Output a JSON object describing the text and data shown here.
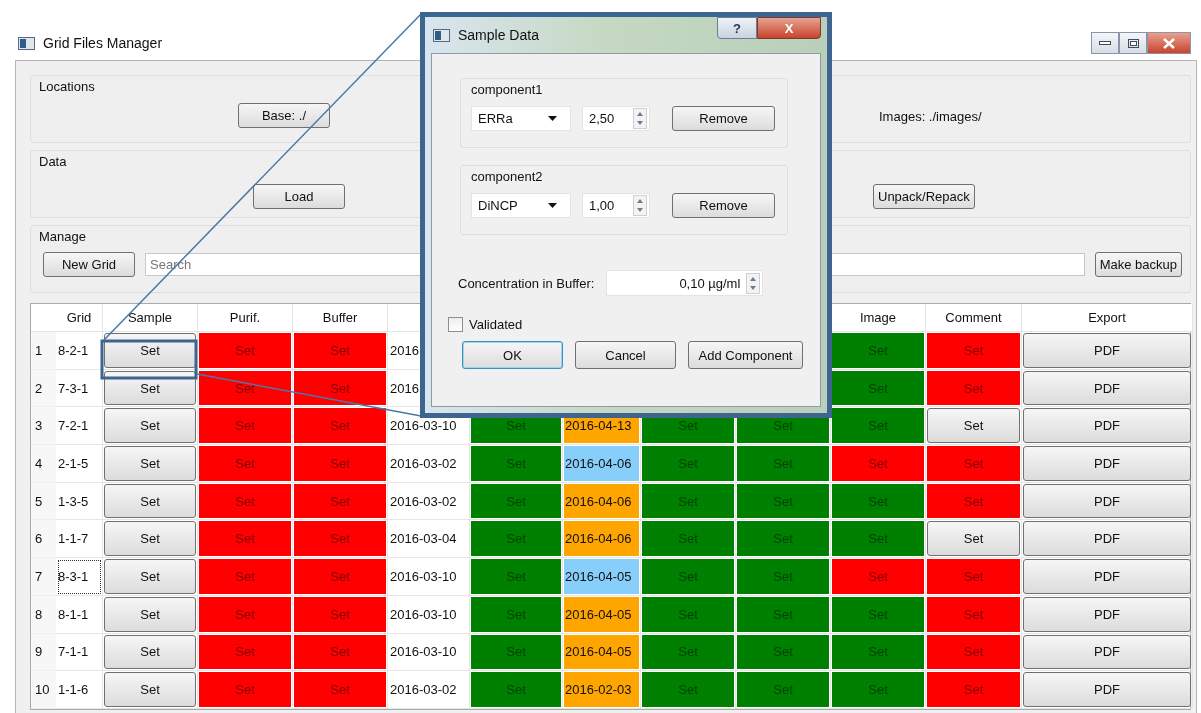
{
  "window": {
    "title": "Grid Files Manager"
  },
  "locations": {
    "title": "Locations",
    "base_button": "Base: ./",
    "images_label": "Images: ./images/"
  },
  "data": {
    "title": "Data",
    "load_button": "Load",
    "unpack_button": "Unpack/Repack"
  },
  "manage": {
    "title": "Manage",
    "new_grid_button": "New Grid",
    "search": {
      "placeholder": "Search"
    },
    "backup_button": "Make backup"
  },
  "table": {
    "header": {
      "grid": "Grid",
      "sample": "Sample",
      "purif": "Purif.",
      "buffer": "Buffer",
      "image": "Image",
      "comment": "Comment",
      "export": "Export"
    },
    "rows": [
      {
        "row_number": "1",
        "focused": false,
        "grid": {
          "kind": "text",
          "text": "8-2-1"
        },
        "sample": {
          "kind": "button",
          "text": "Set"
        },
        "purif": {
          "kind": "status",
          "text": "Set",
          "color": "#ff0000"
        },
        "buffer": {
          "kind": "status",
          "text": "Set",
          "color": "#ff0000"
        },
        "column_5": {
          "kind": "text",
          "text": "2016"
        },
        "image": {
          "kind": "status",
          "text": "Set",
          "color": "#008000"
        },
        "comment": {
          "kind": "status",
          "text": "Set",
          "color": "#ff0000"
        },
        "export": {
          "kind": "button",
          "text": "PDF"
        }
      },
      {
        "row_number": "2",
        "focused": false,
        "grid": {
          "kind": "text",
          "text": "7-3-1"
        },
        "sample": {
          "kind": "button",
          "text": "Set"
        },
        "purif": {
          "kind": "status",
          "text": "Set",
          "color": "#ff0000"
        },
        "buffer": {
          "kind": "status",
          "text": "Set",
          "color": "#ff0000"
        },
        "column_5": {
          "kind": "text",
          "text": "2016"
        },
        "image": {
          "kind": "status",
          "text": "Set",
          "color": "#008000"
        },
        "comment": {
          "kind": "status",
          "text": "Set",
          "color": "#ff0000"
        },
        "export": {
          "kind": "button",
          "text": "PDF"
        }
      },
      {
        "row_number": "3",
        "focused": false,
        "grid": {
          "kind": "text",
          "text": "7-2-1"
        },
        "sample": {
          "kind": "button",
          "text": "Set"
        },
        "purif": {
          "kind": "status",
          "text": "Set",
          "color": "#ff0000"
        },
        "buffer": {
          "kind": "status",
          "text": "Set",
          "color": "#ff0000"
        },
        "column_5": {
          "kind": "text",
          "text": "2016-03-10"
        },
        "column_6": {
          "kind": "status",
          "text": "Set",
          "color": "#008000"
        },
        "column_7": {
          "kind": "text",
          "text": "2016-04-13",
          "color": "#ffa500"
        },
        "column_8": {
          "kind": "status",
          "text": "Set",
          "color": "#008000"
        },
        "column_9": {
          "kind": "status",
          "text": "Set",
          "color": "#008000"
        },
        "image": {
          "kind": "status",
          "text": "Set",
          "color": "#008000"
        },
        "comment": {
          "kind": "button",
          "text": "Set"
        },
        "export": {
          "kind": "button",
          "text": "PDF"
        }
      },
      {
        "row_number": "4",
        "focused": false,
        "grid": {
          "kind": "text",
          "text": "2-1-5"
        },
        "sample": {
          "kind": "button",
          "text": "Set"
        },
        "purif": {
          "kind": "status",
          "text": "Set",
          "color": "#ff0000"
        },
        "buffer": {
          "kind": "status",
          "text": "Set",
          "color": "#ff0000"
        },
        "column_5": {
          "kind": "text",
          "text": "2016-03-02"
        },
        "column_6": {
          "kind": "status",
          "text": "Set",
          "color": "#008000"
        },
        "column_7": {
          "kind": "text",
          "text": "2016-04-06",
          "color": "#87cefa"
        },
        "column_8": {
          "kind": "status",
          "text": "Set",
          "color": "#008000"
        },
        "column_9": {
          "kind": "status",
          "text": "Set",
          "color": "#008000"
        },
        "image": {
          "kind": "status",
          "text": "Set",
          "color": "#ff0000"
        },
        "comment": {
          "kind": "status",
          "text": "Set",
          "color": "#ff0000"
        },
        "export": {
          "kind": "button",
          "text": "PDF"
        }
      },
      {
        "row_number": "5",
        "focused": false,
        "grid": {
          "kind": "text",
          "text": "1-3-5"
        },
        "sample": {
          "kind": "button",
          "text": "Set"
        },
        "purif": {
          "kind": "status",
          "text": "Set",
          "color": "#ff0000"
        },
        "buffer": {
          "kind": "status",
          "text": "Set",
          "color": "#ff0000"
        },
        "column_5": {
          "kind": "text",
          "text": "2016-03-02"
        },
        "column_6": {
          "kind": "status",
          "text": "Set",
          "color": "#008000"
        },
        "column_7": {
          "kind": "text",
          "text": "2016-04-06",
          "color": "#ffa500"
        },
        "column_8": {
          "kind": "status",
          "text": "Set",
          "color": "#008000"
        },
        "column_9": {
          "kind": "status",
          "text": "Set",
          "color": "#008000"
        },
        "image": {
          "kind": "status",
          "text": "Set",
          "color": "#008000"
        },
        "comment": {
          "kind": "status",
          "text": "Set",
          "color": "#ff0000"
        },
        "export": {
          "kind": "button",
          "text": "PDF"
        }
      },
      {
        "row_number": "6",
        "focused": false,
        "grid": {
          "kind": "text",
          "text": "1-1-7"
        },
        "sample": {
          "kind": "button",
          "text": "Set"
        },
        "purif": {
          "kind": "status",
          "text": "Set",
          "color": "#ff0000"
        },
        "buffer": {
          "kind": "status",
          "text": "Set",
          "color": "#ff0000"
        },
        "column_5": {
          "kind": "text",
          "text": "2016-03-04"
        },
        "column_6": {
          "kind": "status",
          "text": "Set",
          "color": "#008000"
        },
        "column_7": {
          "kind": "text",
          "text": "2016-04-06",
          "color": "#ffa500"
        },
        "column_8": {
          "kind": "status",
          "text": "Set",
          "color": "#008000"
        },
        "column_9": {
          "kind": "status",
          "text": "Set",
          "color": "#008000"
        },
        "image": {
          "kind": "status",
          "text": "Set",
          "color": "#008000"
        },
        "comment": {
          "kind": "button",
          "text": "Set"
        },
        "export": {
          "kind": "button",
          "text": "PDF"
        }
      },
      {
        "row_number": "7",
        "focused": true,
        "grid": {
          "kind": "text",
          "text": "8-3-1"
        },
        "sample": {
          "kind": "button",
          "text": "Set"
        },
        "purif": {
          "kind": "status",
          "text": "Set",
          "color": "#ff0000"
        },
        "buffer": {
          "kind": "status",
          "text": "Set",
          "color": "#ff0000"
        },
        "column_5": {
          "kind": "text",
          "text": "2016-03-10"
        },
        "column_6": {
          "kind": "status",
          "text": "Set",
          "color": "#008000"
        },
        "column_7": {
          "kind": "text",
          "text": "2016-04-05",
          "color": "#87cefa"
        },
        "column_8": {
          "kind": "status",
          "text": "Set",
          "color": "#008000"
        },
        "column_9": {
          "kind": "status",
          "text": "Set",
          "color": "#008000"
        },
        "image": {
          "kind": "status",
          "text": "Set",
          "color": "#ff0000"
        },
        "comment": {
          "kind": "status",
          "text": "Set",
          "color": "#ff0000"
        },
        "export": {
          "kind": "button",
          "text": "PDF"
        }
      },
      {
        "row_number": "8",
        "focused": false,
        "grid": {
          "kind": "text",
          "text": "8-1-1"
        },
        "sample": {
          "kind": "button",
          "text": "Set"
        },
        "purif": {
          "kind": "status",
          "text": "Set",
          "color": "#ff0000"
        },
        "buffer": {
          "kind": "status",
          "text": "Set",
          "color": "#ff0000"
        },
        "column_5": {
          "kind": "text",
          "text": "2016-03-10"
        },
        "column_6": {
          "kind": "status",
          "text": "Set",
          "color": "#008000"
        },
        "column_7": {
          "kind": "text",
          "text": "2016-04-05",
          "color": "#ffa500"
        },
        "column_8": {
          "kind": "status",
          "text": "Set",
          "color": "#008000"
        },
        "column_9": {
          "kind": "status",
          "text": "Set",
          "color": "#008000"
        },
        "image": {
          "kind": "status",
          "text": "Set",
          "color": "#008000"
        },
        "comment": {
          "kind": "status",
          "text": "Set",
          "color": "#ff0000"
        },
        "export": {
          "kind": "button",
          "text": "PDF"
        }
      },
      {
        "row_number": "9",
        "focused": false,
        "grid": {
          "kind": "text",
          "text": "7-1-1"
        },
        "sample": {
          "kind": "button",
          "text": "Set"
        },
        "purif": {
          "kind": "status",
          "text": "Set",
          "color": "#ff0000"
        },
        "buffer": {
          "kind": "status",
          "text": "Set",
          "color": "#ff0000"
        },
        "column_5": {
          "kind": "text",
          "text": "2016-03-10"
        },
        "column_6": {
          "kind": "status",
          "text": "Set",
          "color": "#008000"
        },
        "column_7": {
          "kind": "text",
          "text": "2016-04-05",
          "color": "#ffa500"
        },
        "column_8": {
          "kind": "status",
          "text": "Set",
          "color": "#008000"
        },
        "column_9": {
          "kind": "status",
          "text": "Set",
          "color": "#008000"
        },
        "image": {
          "kind": "status",
          "text": "Set",
          "color": "#008000"
        },
        "comment": {
          "kind": "status",
          "text": "Set",
          "color": "#ff0000"
        },
        "export": {
          "kind": "button",
          "text": "PDF"
        }
      },
      {
        "row_number": "10",
        "focused": false,
        "grid": {
          "kind": "text",
          "text": "1-1-6"
        },
        "sample": {
          "kind": "button",
          "text": "Set"
        },
        "purif": {
          "kind": "status",
          "text": "Set",
          "color": "#ff0000"
        },
        "buffer": {
          "kind": "status",
          "text": "Set",
          "color": "#ff0000"
        },
        "column_5": {
          "kind": "text",
          "text": "2016-03-02"
        },
        "column_6": {
          "kind": "status",
          "text": "Set",
          "color": "#008000"
        },
        "column_7": {
          "kind": "text",
          "text": "2016-02-03",
          "color": "#ffa500"
        },
        "column_8": {
          "kind": "status",
          "text": "Set",
          "color": "#008000"
        },
        "column_9": {
          "kind": "status",
          "text": "Set",
          "color": "#008000"
        },
        "image": {
          "kind": "status",
          "text": "Set",
          "color": "#008000"
        },
        "comment": {
          "kind": "status",
          "text": "Set",
          "color": "#ff0000"
        },
        "export": {
          "kind": "button",
          "text": "PDF"
        }
      }
    ]
  },
  "dialog": {
    "title": "Sample Data",
    "help_button": "?",
    "close_button": "X",
    "components": [
      {
        "title": "component1",
        "substance": "ERRa",
        "amount": "2,50",
        "remove_button": "Remove"
      },
      {
        "title": "component2",
        "substance": "DiNCP",
        "amount": "1,00",
        "remove_button": "Remove"
      }
    ],
    "concentration": {
      "label": "Concentration in Buffer:",
      "value": "0,10 µg/ml"
    },
    "validated": {
      "label": "Validated",
      "checked": false
    },
    "buttons": [
      {
        "label": "OK",
        "default": true
      },
      {
        "label": "Cancel",
        "default": false
      },
      {
        "label": "Add Component",
        "default": false
      }
    ]
  }
}
